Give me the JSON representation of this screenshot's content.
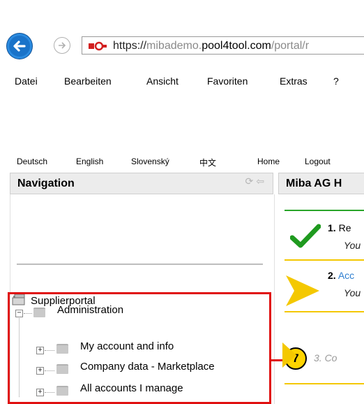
{
  "browser": {
    "url_scheme": "https://",
    "url_sub": "mibademo.",
    "url_domain": "pool4tool.com",
    "url_path": "/portal/r",
    "icons": {
      "back": "back-arrow-icon",
      "forward": "forward-arrow-icon",
      "site": "site-identity-icon"
    }
  },
  "menubar": {
    "items": [
      "Datei",
      "Bearbeiten",
      "Ansicht",
      "Favoriten",
      "Extras",
      "?"
    ]
  },
  "languages": [
    "Deutsch",
    "English",
    "Slovenský",
    "中文"
  ],
  "toplinks": {
    "home": "Home",
    "logout": "Logout"
  },
  "navigation": {
    "title": "Navigation",
    "root": "Supplierportal",
    "admin": "Administration",
    "children": [
      "My account and info",
      "Company data - Marketplace",
      "All accounts I manage"
    ]
  },
  "callout": {
    "number": "7"
  },
  "main": {
    "title": "Miba AG H",
    "steps": [
      {
        "num": "1.",
        "label": "Re",
        "sub": "You"
      },
      {
        "num": "2.",
        "label": "Acc",
        "sub": "You"
      },
      {
        "num": "",
        "label": "3. Co",
        "sub": ""
      }
    ]
  },
  "colors": {
    "accent_red": "#e01010",
    "callout_yellow": "#ffd400",
    "step_green": "#2aa52a",
    "step_yellow": "#f4c800",
    "link_blue": "#2f7fd0"
  }
}
